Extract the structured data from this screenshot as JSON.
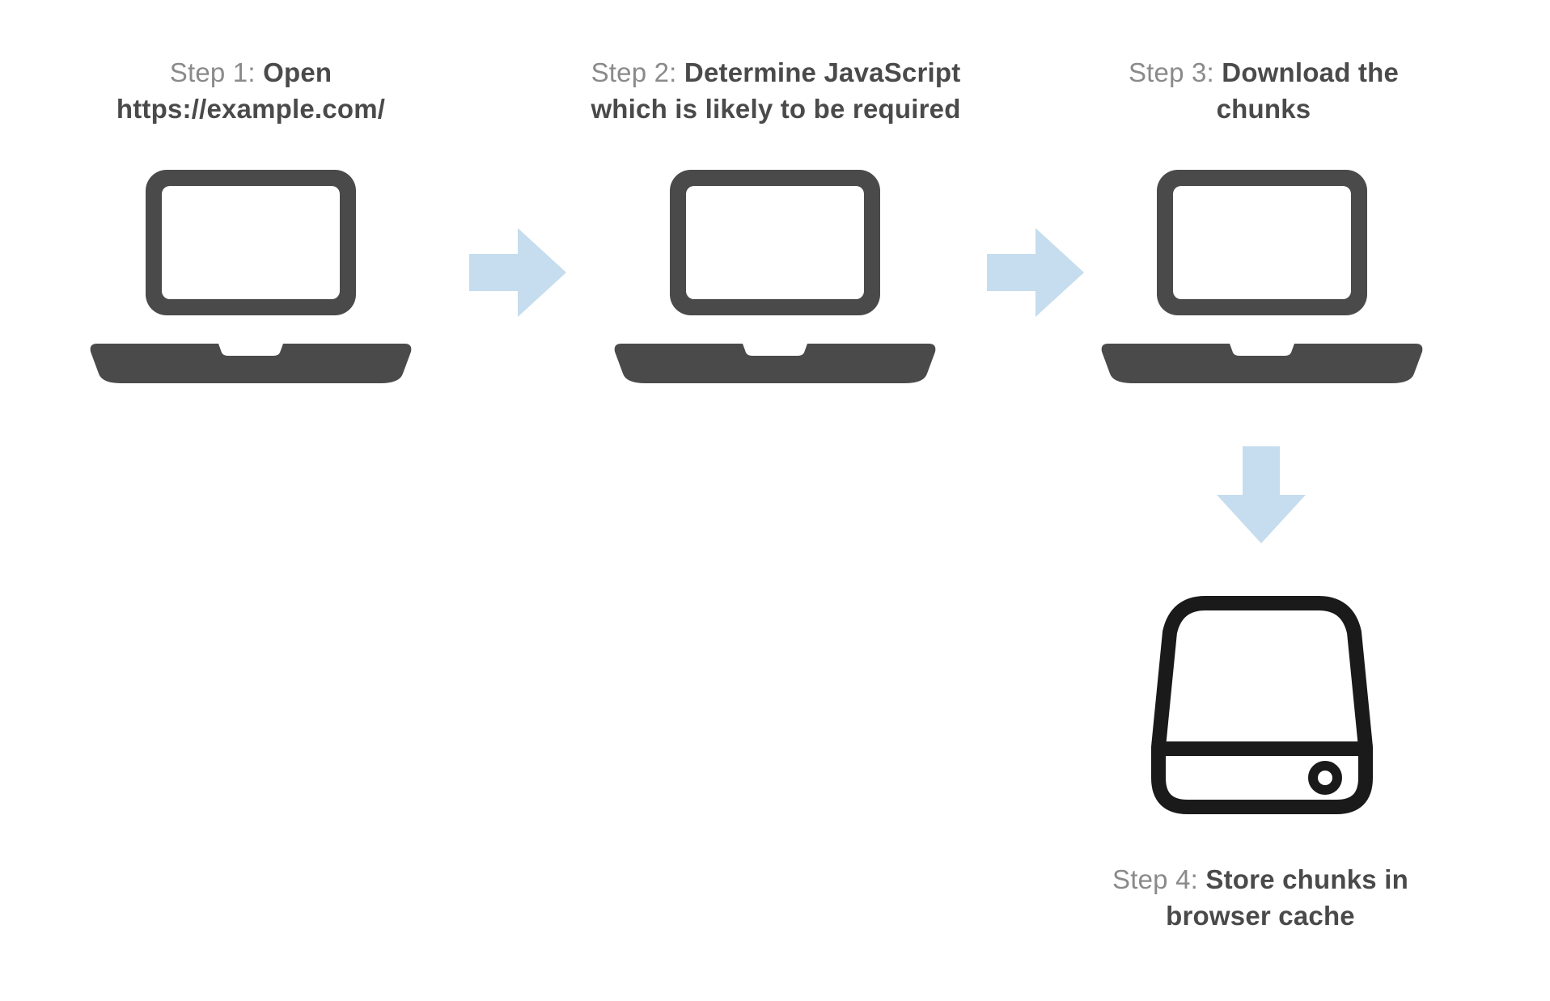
{
  "steps": {
    "s1": {
      "prefix": "Step 1: ",
      "bold": "Open https://example.com/"
    },
    "s2": {
      "prefix": "Step 2: ",
      "bold": "Determine JavaScript which is likely to be required"
    },
    "s3": {
      "prefix": "Step 3: ",
      "bold": "Download the chunks"
    },
    "s4": {
      "prefix": "Step 4: ",
      "bold": "Store chunks in browser cache"
    }
  },
  "colors": {
    "laptop": "#4a4a4a",
    "arrow": "#C5DDEE",
    "hdd": "#1a1a1a"
  }
}
